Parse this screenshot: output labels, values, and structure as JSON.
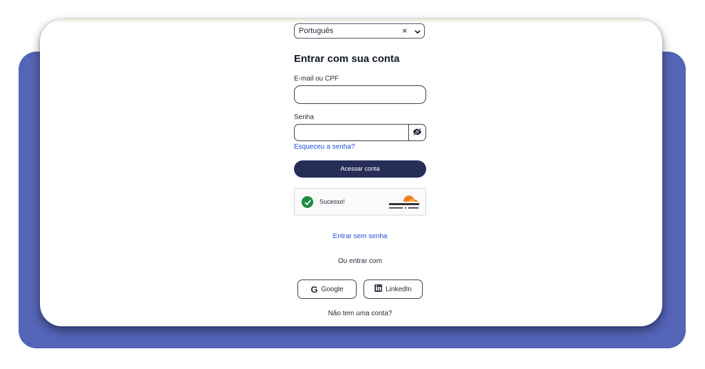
{
  "language_select": {
    "value": "Português",
    "clear_icon": "close-icon",
    "toggle_icon": "chevron-down-icon"
  },
  "login": {
    "title": "Entrar com sua conta",
    "email_label": "E-mail ou CPF",
    "email_value": "",
    "password_label": "Senha",
    "password_value": "",
    "password_toggle_icon": "eye-off-icon",
    "forgot_password": "Esqueceu a senha?",
    "submit_label": "Acessar conta"
  },
  "captcha": {
    "status": "Sucesso!",
    "provider_logo": "cloudflare-logo",
    "status_icon": "check-circle-icon"
  },
  "passwordless_link": "Entrar sem senha",
  "alt_login_label": "Ou entrar com",
  "social": [
    {
      "label": "Google",
      "icon": "google-icon"
    },
    {
      "label": "LinkedIn",
      "icon": "linkedin-icon"
    }
  ],
  "signup_prompt": "Não tem uma conta?",
  "colors": {
    "accent": "#262e57",
    "backdrop": "#5465b8",
    "link": "#1d4ed8",
    "success": "#1d8b3e",
    "cloudflare": "#f38020"
  }
}
